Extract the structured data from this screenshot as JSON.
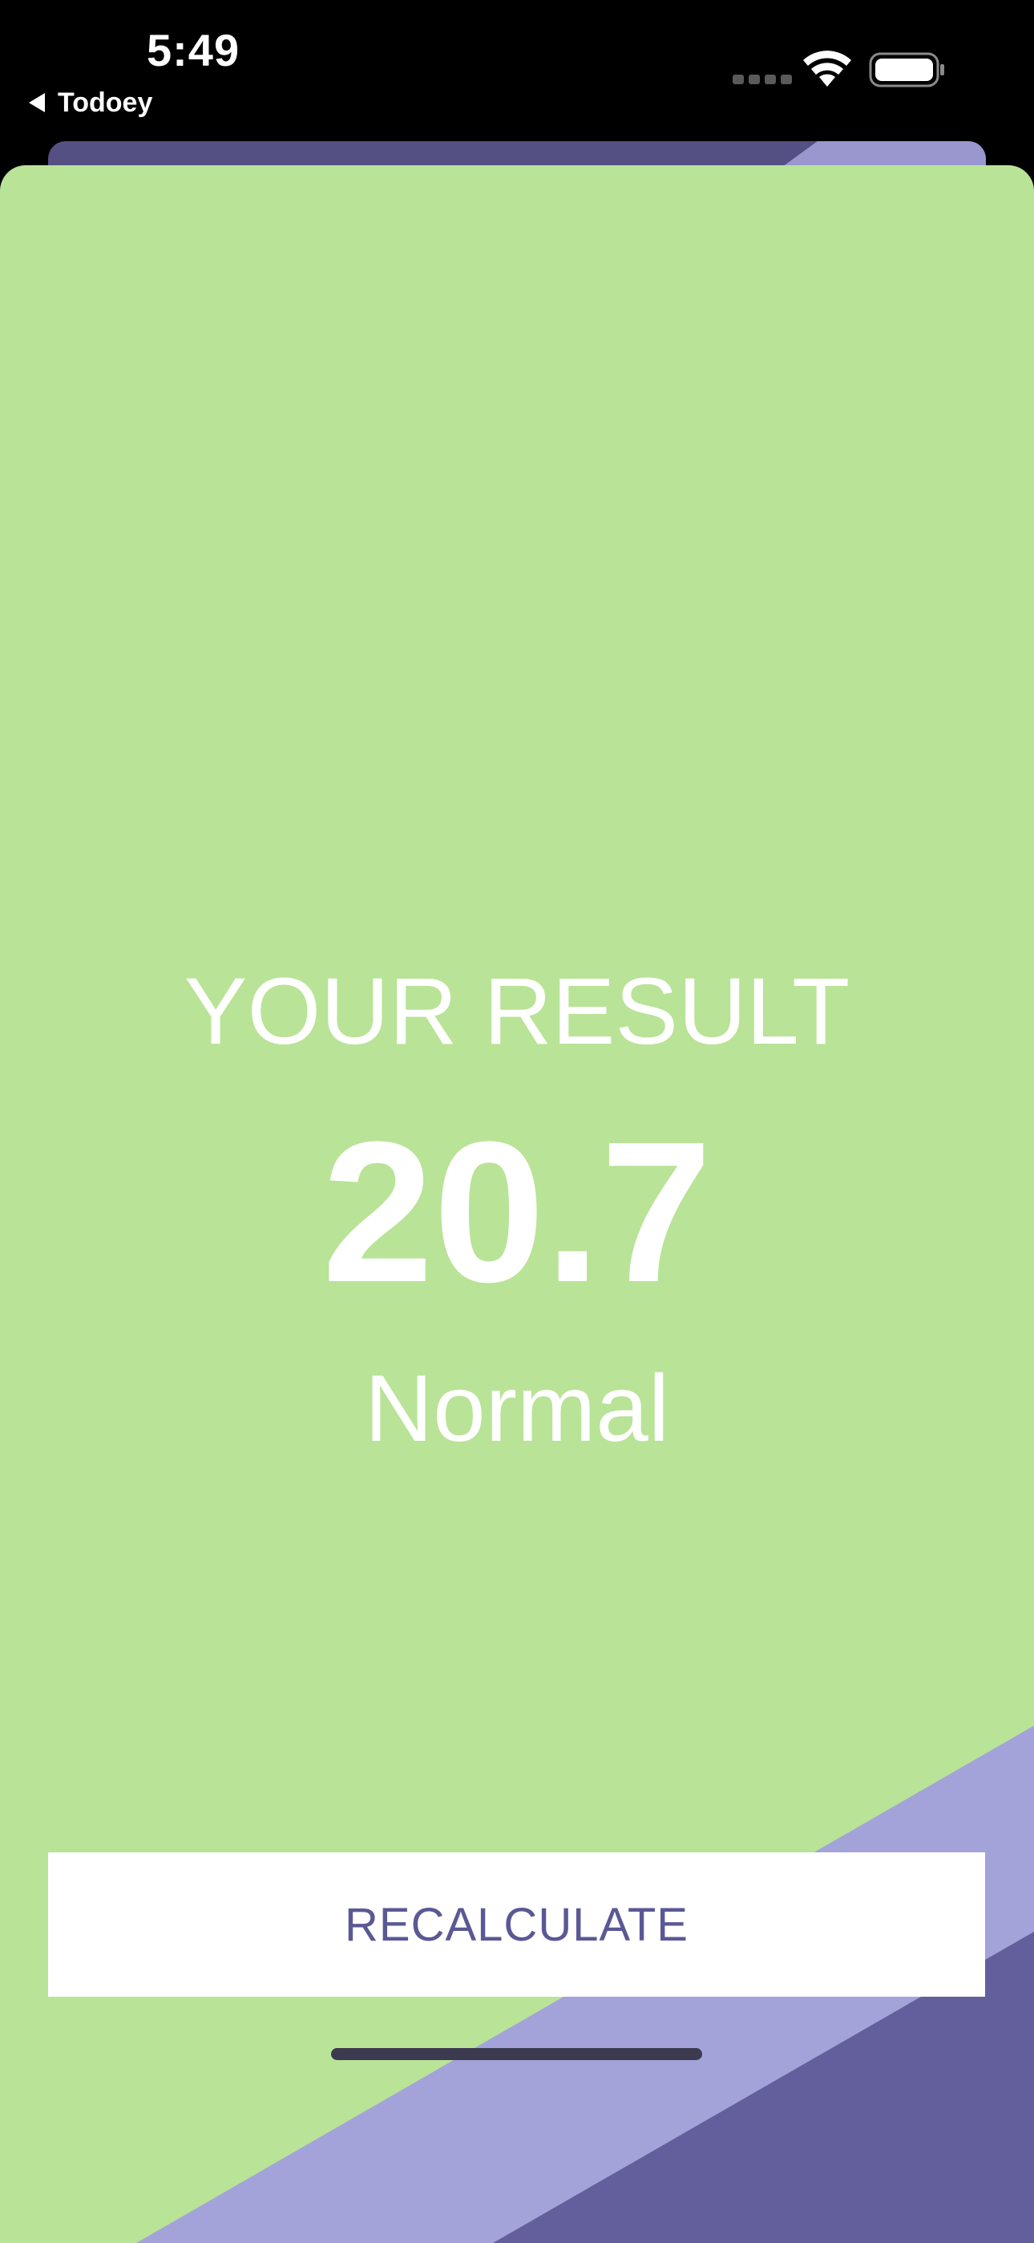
{
  "status_bar": {
    "time": "5:49",
    "back_label": "Todoey",
    "icons": [
      "signal-dots-icon",
      "wifi-icon",
      "battery-icon"
    ]
  },
  "result": {
    "title": "YOUR RESULT",
    "value": "20.7",
    "status": "Normal"
  },
  "actions": {
    "recalculate_label": "RECALCULATE"
  },
  "colors": {
    "background": "#000000",
    "sheet": "#b9e397",
    "stripe_light": "#a3a3da",
    "stripe_dark": "#625f9c",
    "button_text": "#5b5895",
    "text": "#ffffff"
  }
}
